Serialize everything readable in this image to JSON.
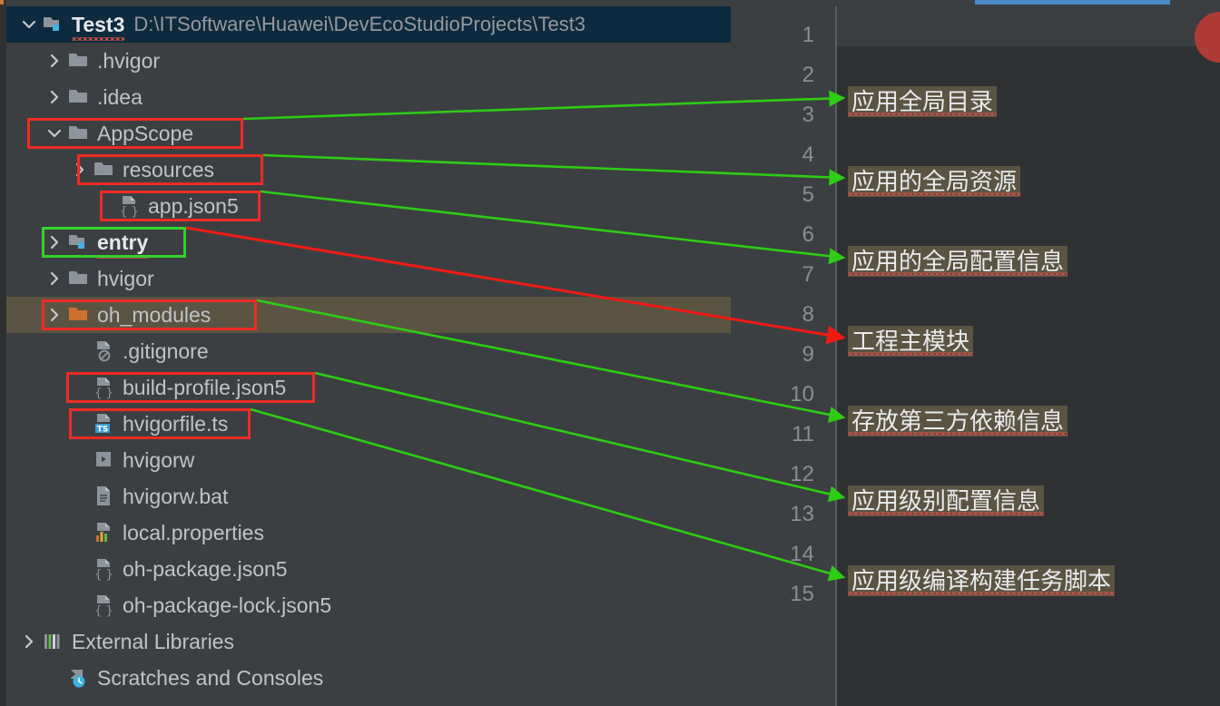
{
  "window": {
    "theme_bg": "#3c3f41",
    "editor_bg": "#2f3133",
    "selection_bg": "#0d2a3f",
    "highlight_bg": "#5b5442",
    "accent_blue": "#4a88c7",
    "annotation_box_red": "#ef2b24",
    "annotation_box_green": "#35d12c",
    "arrow_green": "#2ecc14",
    "arrow_red": "#ee1b15"
  },
  "project_tree": {
    "root": {
      "name": "Test3",
      "path": "D:\\ITSoftware\\Huawei\\DevEcoStudioProjects\\Test3",
      "icon": "module-folder-icon",
      "expanded": true,
      "selected": true
    },
    "items": [
      {
        "label": ".hvigor",
        "icon": "folder-icon",
        "indent": 1,
        "arrow": "chevron-right",
        "state": "normal"
      },
      {
        "label": ".idea",
        "icon": "folder-icon",
        "indent": 1,
        "arrow": "chevron-right",
        "state": "normal"
      },
      {
        "label": "AppScope",
        "icon": "folder-icon",
        "indent": 1,
        "arrow": "chevron-down",
        "state": "normal"
      },
      {
        "label": "resources",
        "icon": "folder-icon",
        "indent": 2,
        "arrow": "chevron-right",
        "state": "normal"
      },
      {
        "label": "app.json5",
        "icon": "json5-file-icon",
        "indent": 3,
        "arrow": "none",
        "state": "normal"
      },
      {
        "label": "entry",
        "icon": "module-folder-icon",
        "indent": 1,
        "arrow": "chevron-right",
        "state": "bold"
      },
      {
        "label": "hvigor",
        "icon": "folder-icon",
        "indent": 1,
        "arrow": "chevron-right",
        "state": "normal"
      },
      {
        "label": "oh_modules",
        "icon": "orange-folder-icon",
        "indent": 1,
        "arrow": "chevron-right",
        "state": "highlighted"
      },
      {
        "label": ".gitignore",
        "icon": "gitignore-file-icon",
        "indent": 2,
        "arrow": "none",
        "state": "normal"
      },
      {
        "label": "build-profile.json5",
        "icon": "json5-file-icon",
        "indent": 2,
        "arrow": "none",
        "state": "normal"
      },
      {
        "label": "hvigorfile.ts",
        "icon": "ts-file-icon",
        "indent": 2,
        "arrow": "none",
        "state": "normal"
      },
      {
        "label": "hvigorw",
        "icon": "script-file-icon",
        "indent": 2,
        "arrow": "none",
        "state": "normal"
      },
      {
        "label": "hvigorw.bat",
        "icon": "text-file-icon",
        "indent": 2,
        "arrow": "none",
        "state": "normal"
      },
      {
        "label": "local.properties",
        "icon": "properties-file-icon",
        "indent": 2,
        "arrow": "none",
        "state": "normal"
      },
      {
        "label": "oh-package.json5",
        "icon": "json5-file-icon",
        "indent": 2,
        "arrow": "none",
        "state": "normal"
      },
      {
        "label": "oh-package-lock.json5",
        "icon": "json5-file-icon",
        "indent": 2,
        "arrow": "none",
        "state": "normal"
      },
      {
        "label": "External Libraries",
        "icon": "libraries-icon",
        "indent": 0,
        "arrow": "chevron-right",
        "state": "normal"
      },
      {
        "label": "Scratches and Consoles",
        "icon": "scratches-icon",
        "indent": 1,
        "arrow": "none",
        "state": "normal"
      }
    ]
  },
  "editor": {
    "line_numbers": [
      "1",
      "2",
      "3",
      "4",
      "5",
      "6",
      "7",
      "8",
      "9",
      "10",
      "11",
      "12",
      "13",
      "14",
      "15"
    ],
    "annotations": [
      {
        "text": "应用全局目录",
        "line": 3
      },
      {
        "text": "应用的全局资源",
        "line": 5
      },
      {
        "text": "应用的全局配置信息",
        "line": 7
      },
      {
        "text": "工程主模块",
        "line": 9
      },
      {
        "text": "存放第三方依赖信息",
        "line": 11
      },
      {
        "text": "应用级别配置信息",
        "line": 13
      },
      {
        "text": "应用级编译构建任务脚本",
        "line": 15
      }
    ]
  },
  "callouts": {
    "boxes": [
      {
        "target": "AppScope",
        "color": "red"
      },
      {
        "target": "resources",
        "color": "red"
      },
      {
        "target": "app.json5",
        "color": "red"
      },
      {
        "target": "entry",
        "color": "green"
      },
      {
        "target": "oh_modules",
        "color": "red"
      },
      {
        "target": "build-profile.json5",
        "color": "red"
      },
      {
        "target": "hvigorfile.ts",
        "color": "red"
      }
    ],
    "arrows": [
      {
        "from": "AppScope",
        "to": "应用全局目录",
        "color": "green"
      },
      {
        "from": "resources",
        "to": "应用的全局资源",
        "color": "green"
      },
      {
        "from": "app.json5",
        "to": "应用的全局配置信息",
        "color": "green"
      },
      {
        "from": "entry",
        "to": "工程主模块",
        "color": "red"
      },
      {
        "from": "oh_modules",
        "to": "存放第三方依赖信息",
        "color": "green"
      },
      {
        "from": "build-profile.json5",
        "to": "应用级别配置信息",
        "color": "green"
      },
      {
        "from": "hvigorfile.ts",
        "to": "应用级编译构建任务脚本",
        "color": "green"
      }
    ]
  }
}
